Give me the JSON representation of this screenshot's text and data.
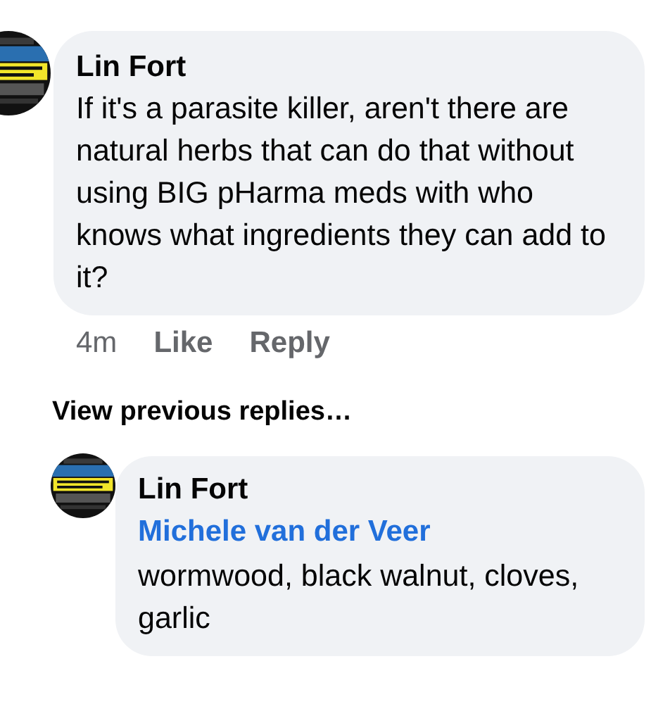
{
  "comment": {
    "author": "Lin Fort",
    "text": "If it's a parasite killer, aren't there are natural herbs that can do that without using BIG pHarma meds with who knows what ingredients they can add to it?",
    "actions": [
      {
        "kind": "time",
        "label": "4m"
      },
      {
        "kind": "link",
        "label": "Like"
      },
      {
        "kind": "link",
        "label": "Reply"
      }
    ]
  },
  "view_previous": "View previous replies…",
  "reply": {
    "author": "Lin Fort",
    "mention": "Michele van der Veer",
    "text": "wormwood, black walnut, cloves, garlic"
  }
}
